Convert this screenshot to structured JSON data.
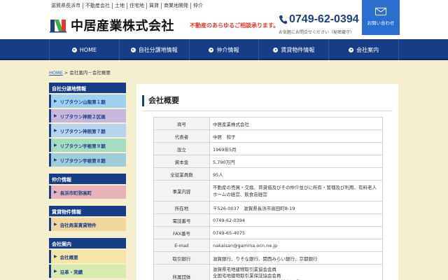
{
  "header": {
    "tags": [
      "滋賀県長浜市",
      "不動産会社",
      "土地",
      "住宅地",
      "賃貸",
      "商業地開発",
      "仲介"
    ],
    "company_name": "中居産業株式会社",
    "tagline": "不動産のあらゆるご相談承ります。",
    "phone": "0749-62-0394",
    "phone_note": "お気軽にお問合せください（秘密厳守）",
    "contact_label": "お問い合わせ"
  },
  "nav": {
    "items": [
      "HOME",
      "自社分譲地情報",
      "仲介情報",
      "賃貸物件情報",
      "会社案内"
    ]
  },
  "breadcrumb": {
    "home": "HOME",
    "separator": " > ",
    "current": "会社案内－会社概要"
  },
  "sidebar": {
    "sections": [
      {
        "title": "自社分譲地情報",
        "items": [
          "リブタウン山階第１期",
          "リブタウン神照２区画",
          "リブタウン神照第７期",
          "リブタウン宇根第９期",
          "リブタウン宇根第８期"
        ]
      },
      {
        "title": "仲介情報",
        "items": [
          "長浜市町弥高町"
        ]
      },
      {
        "title": "賃貸物件情報",
        "items": [
          "自社商業賃貸物件"
        ]
      },
      {
        "title": "会社案内",
        "items": [
          "会社概要",
          "沿革・実績"
        ]
      }
    ]
  },
  "main": {
    "title": "会社概要",
    "rows": [
      {
        "key": "商号",
        "value": "中居産業株式会社"
      },
      {
        "key": "代表者",
        "value": "中居　和子"
      },
      {
        "key": "設立",
        "value": "1969年5月"
      },
      {
        "key": "資本金",
        "value": "5,790万円"
      },
      {
        "key": "全従業員数",
        "value": "95人"
      },
      {
        "key": "事業内容",
        "value": "不動産の売買・交換、賃貸借及びその仲介並びに所有・管理及び利用、有料老人ホームの経営、飲食店経営"
      },
      {
        "key": "所在地",
        "value": "〒526-0037　滋賀県長浜市高田町8-19"
      },
      {
        "key": "電話番号",
        "value": "0749-62-0394"
      },
      {
        "key": "FAX番号",
        "value": "0749-65-4075"
      },
      {
        "key": "E-mail",
        "value": "nakaisan@gamma.ocn.ne.jp"
      },
      {
        "key": "取引銀行",
        "value": "滋賀銀行、りそな銀行、関西みらい銀行、京都銀行"
      },
      {
        "key": "所属団体",
        "value": "滋賀県宅地建物取引業協会会員\n全国宅地建物取引業保証協会会員\n（社）近畿地区不動産公正取引協議会加盟"
      }
    ]
  },
  "colors": {
    "navy": "#163d85",
    "blue_button": "#2a6ed1",
    "accent_red": "#e23a2b",
    "background_cream": "#f5efcf",
    "sidebar_item_colors": [
      "#9ed0ef",
      "#c8b7dd",
      "#b7d3ee",
      "#a6dcc2",
      "#9dcdd9",
      "#e7b3b6",
      "#f1d69d",
      "#f5e6a8",
      "#d8eab0"
    ]
  }
}
